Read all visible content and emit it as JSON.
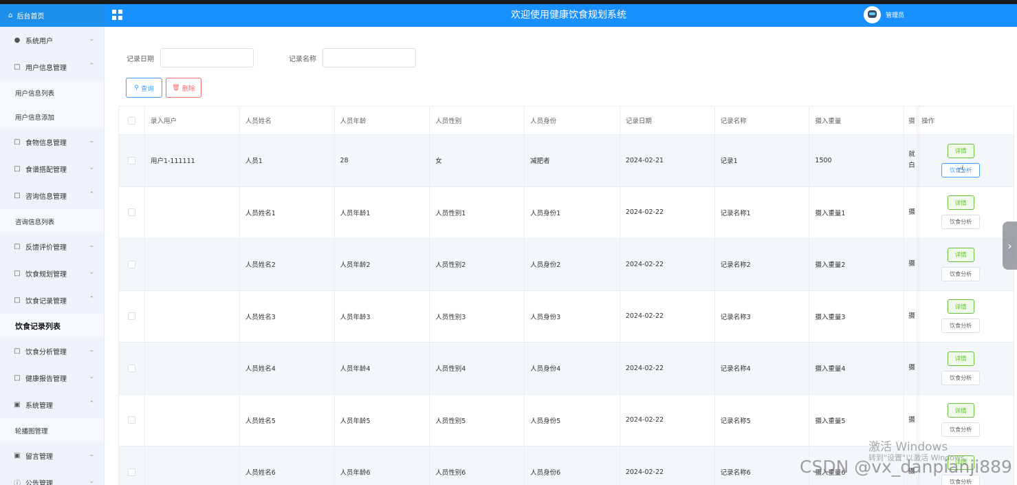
{
  "header": {
    "brand_label": "后台首页",
    "brand_icon": "home-icon",
    "menu_icon": "grid-menu-icon",
    "title": "欢迎使用健康饮食规划系统",
    "username": "管理员",
    "avatar_icon": "robot-avatar-icon",
    "color": "#1890ff"
  },
  "sidebar": {
    "items": [
      {
        "label": "系统用户",
        "icon": "user-icon",
        "expanded": false
      },
      {
        "label": "用户信息管理",
        "icon": "folder-icon",
        "expanded": true,
        "children": [
          "用户信息列表",
          "用户信息添加"
        ]
      },
      {
        "label": "食物信息管理",
        "icon": "folder-icon",
        "expanded": false
      },
      {
        "label": "食谱搭配管理",
        "icon": "folder-icon",
        "expanded": false
      },
      {
        "label": "咨询信息管理",
        "icon": "folder-icon",
        "expanded": true,
        "children": [
          "咨询信息列表"
        ]
      },
      {
        "label": "反馈评价管理",
        "icon": "folder-icon",
        "expanded": false
      },
      {
        "label": "饮食规划管理",
        "icon": "folder-icon",
        "expanded": false
      },
      {
        "label": "饮食记录管理",
        "icon": "folder-icon",
        "expanded": true,
        "children": [
          "饮食记录列表"
        ]
      },
      {
        "label": "饮食分析管理",
        "icon": "folder-icon",
        "expanded": false
      },
      {
        "label": "健康报告管理",
        "icon": "folder-icon",
        "expanded": false
      },
      {
        "label": "系统管理",
        "icon": "picture-icon",
        "expanded": true,
        "children": [
          "轮播图管理"
        ]
      },
      {
        "label": "留言管理",
        "icon": "picture-icon",
        "expanded": false
      },
      {
        "label": "公告管理",
        "icon": "info-icon",
        "expanded": false
      }
    ],
    "active_child": "饮食记录列表"
  },
  "filters": {
    "date_label": "记录日期",
    "date_value": "",
    "name_label": "记录名称",
    "name_value": ""
  },
  "actions": {
    "search_label": "查询",
    "delete_label": "删除"
  },
  "table": {
    "columns": [
      "录入用户",
      "人员姓名",
      "人员年龄",
      "人员性别",
      "人员身份",
      "记录日期",
      "记录名称",
      "摄入重量",
      "摄",
      "操作"
    ],
    "rows": [
      {
        "user": "用户1-111111",
        "name": "人员1",
        "age": "28",
        "gender": "女",
        "identity": "减肥者",
        "date": "2024-02-21",
        "record": "记录1",
        "weight": "1500",
        "trunc1": "就",
        "trunc2": "白"
      },
      {
        "user": "",
        "name": "人员姓名1",
        "age": "人员年龄1",
        "gender": "人员性别1",
        "identity": "人员身份1",
        "date": "2024-02-22",
        "record": "记录名称1",
        "weight": "摄入重量1",
        "trunc1": "摄",
        "trunc2": ""
      },
      {
        "user": "",
        "name": "人员姓名2",
        "age": "人员年龄2",
        "gender": "人员性别2",
        "identity": "人员身份2",
        "date": "2024-02-22",
        "record": "记录名称2",
        "weight": "摄入重量2",
        "trunc1": "摄",
        "trunc2": ""
      },
      {
        "user": "",
        "name": "人员姓名3",
        "age": "人员年龄3",
        "gender": "人员性别3",
        "identity": "人员身份3",
        "date": "2024-02-22",
        "record": "记录名称3",
        "weight": "摄入重量3",
        "trunc1": "摄",
        "trunc2": ""
      },
      {
        "user": "",
        "name": "人员姓名4",
        "age": "人员年龄4",
        "gender": "人员性别4",
        "identity": "人员身份4",
        "date": "2024-02-22",
        "record": "记录名称4",
        "weight": "摄入重量4",
        "trunc1": "摄",
        "trunc2": ""
      },
      {
        "user": "",
        "name": "人员姓名5",
        "age": "人员年龄5",
        "gender": "人员性别5",
        "identity": "人员身份5",
        "date": "2024-02-22",
        "record": "记录名称5",
        "weight": "摄入重量5",
        "trunc1": "摄",
        "trunc2": ""
      },
      {
        "user": "",
        "name": "人员姓名6",
        "age": "人员年龄6",
        "gender": "人员性别6",
        "identity": "人员身份6",
        "date": "2024-02-22",
        "record": "记录名称6",
        "weight": "摄入重量6",
        "trunc1": "摄",
        "trunc2": ""
      }
    ],
    "detail_label": "详情",
    "analysis_label": "饮食分析"
  },
  "overlay": {
    "activate_title": "激活 Windows",
    "activate_sub": "转到\"设置\"以激活 Windows。",
    "csdn_watermark": "CSDN @vx_danpianji889"
  }
}
